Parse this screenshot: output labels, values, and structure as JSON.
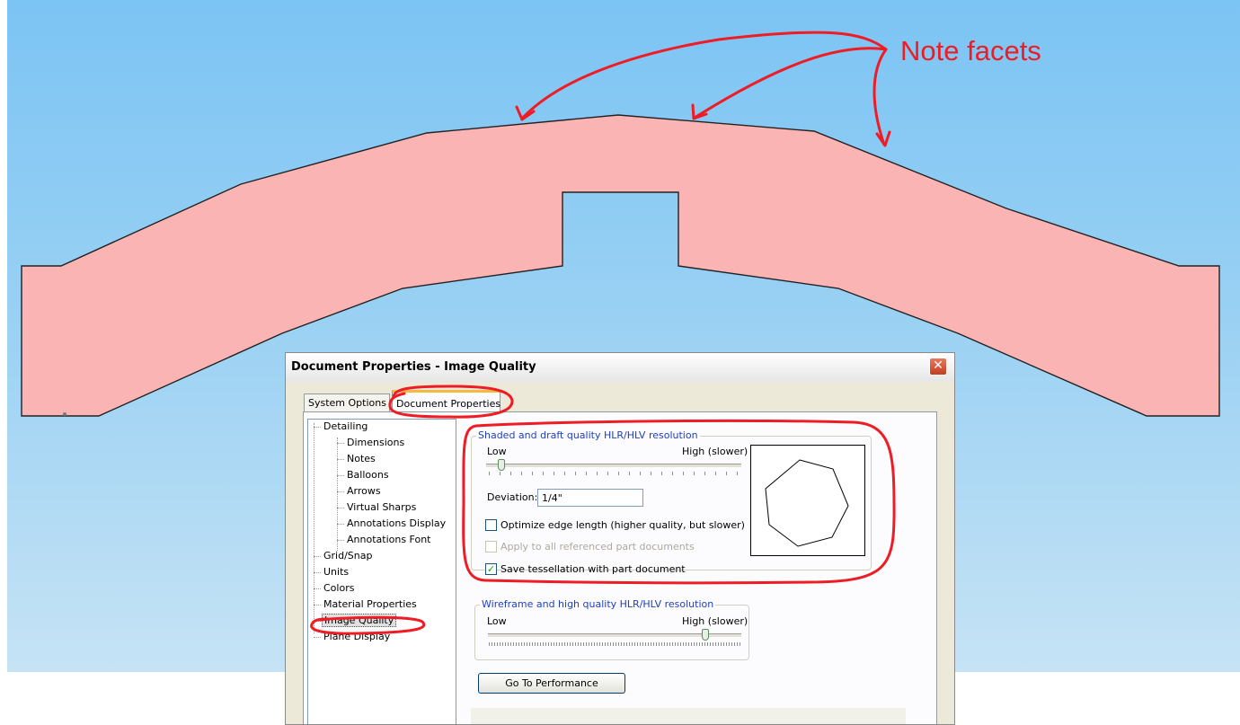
{
  "annotation": {
    "label": "Note facets",
    "color": "#ee1c24"
  },
  "model": {
    "fill_color": "#fbb4b4",
    "background_top": "#7cc4f4",
    "background_bottom": "#c6e3f5"
  },
  "dialog": {
    "title": "Document Properties - Image Quality",
    "close_icon": "close-x-icon",
    "tabs": [
      {
        "label": "System Options",
        "active": false
      },
      {
        "label": "Document Properties",
        "active": true
      }
    ],
    "tree": [
      "Detailing",
      "Dimensions",
      "Notes",
      "Balloons",
      "Arrows",
      "Virtual Sharps",
      "Annotations Display",
      "Annotations Font",
      "Grid/Snap",
      "Units",
      "Colors",
      "Material Properties",
      "Image Quality",
      "Plane Display"
    ],
    "selected_tree_item": "Image Quality",
    "shaded_group": {
      "caption": "Shaded and draft quality HLR/HLV resolution",
      "low_label": "Low",
      "high_label": "High (slower)",
      "slider_level": 0.05,
      "deviation_label": "Deviation:",
      "deviation_value": "1/4\"",
      "optimize_label": "Optimize edge length (higher quality, but slower)",
      "optimize_checked": false,
      "apply_label": "Apply to all referenced part documents",
      "apply_checked": false,
      "apply_enabled": false,
      "save_label": "Save tessellation with part document",
      "save_checked": true
    },
    "wireframe_group": {
      "caption": "Wireframe and high quality HLR/HLV resolution",
      "low_label": "Low",
      "high_label": "High (slower)",
      "slider_level": 0.86
    },
    "performance_button": "Go To Performance"
  }
}
